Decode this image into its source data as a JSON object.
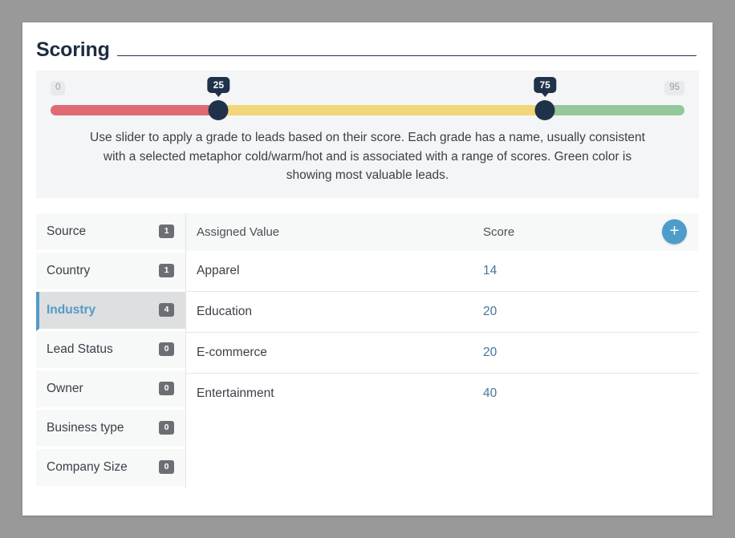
{
  "header": {
    "title": "Scoring"
  },
  "slider": {
    "min_label": "0",
    "max_label": "95",
    "min": 0,
    "max": 95,
    "handles": [
      {
        "value": "25",
        "percent": 26.5
      },
      {
        "value": "75",
        "percent": 78.0
      }
    ],
    "segments": [
      {
        "name": "cold",
        "color": "#de6b74",
        "width_percent": 26.5
      },
      {
        "name": "warm",
        "color": "#f2d77a",
        "width_percent": 51.5
      },
      {
        "name": "hot",
        "color": "#94c79a",
        "width_percent": 22.0
      }
    ],
    "handle_color": "#20324a",
    "description": "Use slider to apply a grade to leads based on their score. Each grade has a name, usually consistent with a selected metaphor cold/warm/hot and is associated with a range of scores. Green color is showing most valuable leads."
  },
  "sidebar": {
    "items": [
      {
        "label": "Source",
        "count": "1",
        "active": false
      },
      {
        "label": "Country",
        "count": "1",
        "active": false
      },
      {
        "label": "Industry",
        "count": "4",
        "active": true
      },
      {
        "label": "Lead Status",
        "count": "0",
        "active": false
      },
      {
        "label": "Owner",
        "count": "0",
        "active": false
      },
      {
        "label": "Business type",
        "count": "0",
        "active": false
      },
      {
        "label": "Company Size",
        "count": "0",
        "active": false
      }
    ],
    "active_color": "#5699c6"
  },
  "table": {
    "columns": {
      "value": "Assigned Value",
      "score": "Score"
    },
    "add_button_label": "+",
    "add_button_color": "#4e9cc9",
    "rows": [
      {
        "value": "Apparel",
        "score": "14"
      },
      {
        "value": "Education",
        "score": "20"
      },
      {
        "value": "E-commerce",
        "score": "20"
      },
      {
        "value": "Entertainment",
        "score": "40"
      }
    ]
  }
}
